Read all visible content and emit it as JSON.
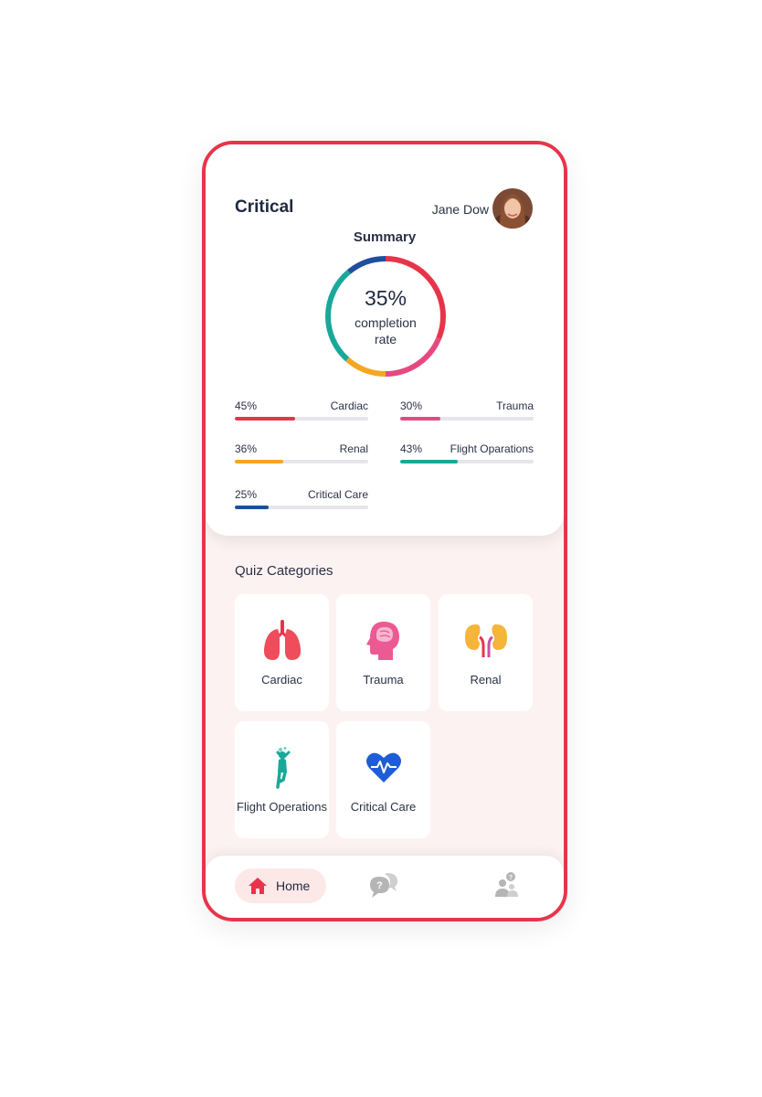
{
  "header": {
    "title": "Critical",
    "user_name": "Jane Dow"
  },
  "summary": {
    "title": "Summary",
    "percent": "35%",
    "label_line1": "completion",
    "label_line2": "rate"
  },
  "stats": [
    {
      "percent": "45%",
      "name": "Cardiac",
      "value": 0.45,
      "color": "#e8344a"
    },
    {
      "percent": "30%",
      "name": "Trauma",
      "value": 0.3,
      "color": "#e64980"
    },
    {
      "percent": "36%",
      "name": "Renal",
      "value": 0.36,
      "color": "#f5a623"
    },
    {
      "percent": "43%",
      "name": "Flight Oparations",
      "value": 0.43,
      "color": "#1aa89a"
    },
    {
      "percent": "25%",
      "name": "Critical Care",
      "value": 0.25,
      "color": "#1f4e9c"
    }
  ],
  "quiz": {
    "title": "Quiz Categories",
    "categories": [
      {
        "label": "Cardiac",
        "icon": "lungs-icon"
      },
      {
        "label": "Trauma",
        "icon": "head-brain-icon"
      },
      {
        "label": "Renal",
        "icon": "kidneys-icon"
      },
      {
        "label": "Flight Operations",
        "icon": "person-jump-icon"
      },
      {
        "label": "Critical Care",
        "icon": "heart-pulse-icon"
      }
    ]
  },
  "nav": {
    "home_label": "Home",
    "items": [
      "home-icon",
      "chat-question-icon",
      "users-question-icon"
    ]
  },
  "colors": {
    "accent": "#e8344a",
    "background": "#fdf2f2",
    "inactive": "#b5b5b5"
  }
}
